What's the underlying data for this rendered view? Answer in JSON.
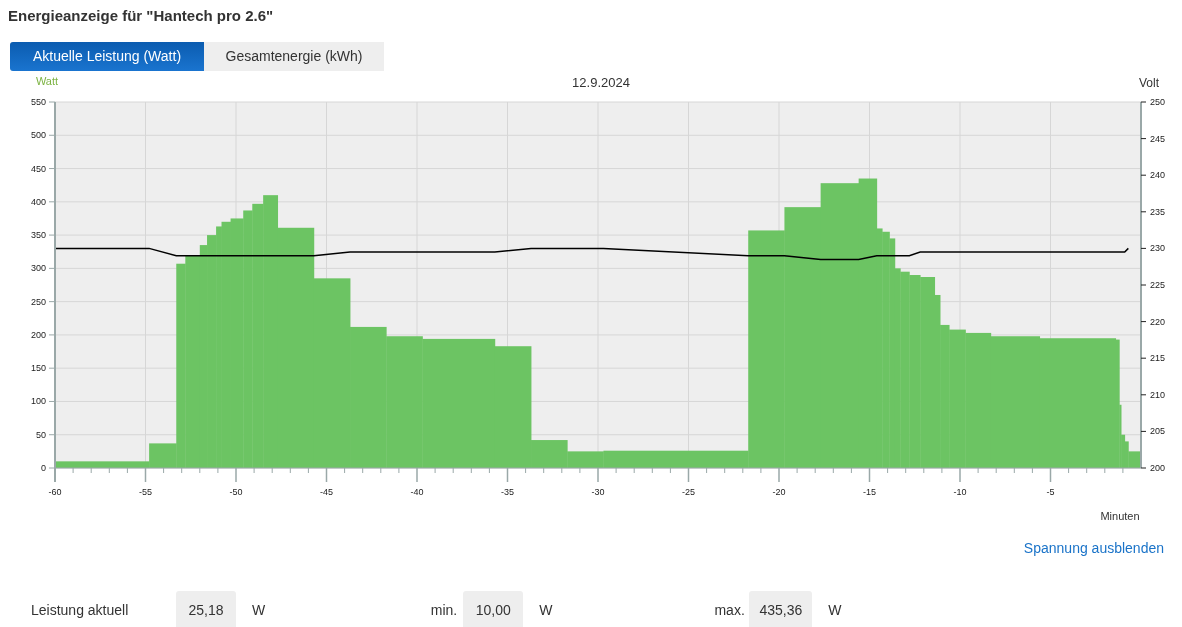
{
  "title": "Energieanzeige für \"Hantech pro 2.6\"",
  "tabs": [
    {
      "label": "Aktuelle Leistung (Watt)",
      "selected": true
    },
    {
      "label": "Gesamtenergie (kWh)",
      "selected": false
    }
  ],
  "chart": {
    "chart_data": {
      "type": "area",
      "title": "12.9.2024",
      "xlabel": "Minuten",
      "ylabel": "Watt",
      "y2label": "Volt",
      "x": [
        -60,
        -54.8,
        -53.3,
        -52.8,
        -52.0,
        -51.6,
        -51.1,
        -50.8,
        -50.3,
        -49.6,
        -49.1,
        -48.5,
        -47.7,
        -45.7,
        -43.7,
        -41.7,
        -39.7,
        -35.7,
        -33.7,
        -31.7,
        -29.7,
        -21.7,
        -19.7,
        -17.7,
        -15.6,
        -14.6,
        -14.3,
        -13.9,
        -13.6,
        -13.3,
        -12.8,
        -12.2,
        -11.4,
        -11.1,
        -10.6,
        -9.7,
        -8.3,
        -5.6,
        -1.4,
        -1.2,
        -1.1,
        -0.9,
        -0.7
      ],
      "series": [
        {
          "color": "#6cc463",
          "values": [
            10,
            37,
            307,
            320,
            335,
            350,
            363,
            370,
            375,
            387,
            397,
            410,
            361,
            285,
            212,
            198,
            194,
            183,
            42,
            25,
            26,
            357,
            392,
            428,
            435,
            360,
            355,
            345,
            300,
            295,
            290,
            287,
            260,
            215,
            208,
            203,
            198,
            195,
            193,
            95,
            50,
            40,
            25
          ]
        },
        {
          "type": "line",
          "axis": "y2",
          "color": "#000000",
          "values": [
            230,
            230,
            229,
            229,
            229,
            229,
            229,
            229,
            229,
            229,
            229,
            229,
            229,
            229,
            229.5,
            229.5,
            229.5,
            229.5,
            230,
            230,
            230,
            229,
            229,
            228.5,
            228.5,
            229,
            229,
            229,
            229,
            229,
            229,
            229.5,
            229.5,
            229.5,
            229.5,
            229.5,
            229.5,
            229.5,
            229.5,
            229.5,
            229.5,
            229.5,
            230
          ]
        }
      ],
      "grid": true,
      "xlim": [
        -60,
        0
      ],
      "ylim": [
        0,
        550
      ],
      "y2lim": [
        200,
        250
      ],
      "xticks": [
        -60,
        -55,
        -50,
        -45,
        -40,
        -35,
        -30,
        -25,
        -20,
        -15,
        -10,
        -5
      ],
      "yticks": [
        0,
        50,
        100,
        150,
        200,
        250,
        300,
        350,
        400,
        450,
        500,
        550
      ],
      "y2ticks": [
        200,
        205,
        210,
        215,
        220,
        225,
        230,
        235,
        240,
        245,
        250
      ]
    }
  },
  "toggle_link": "Spannung ausblenden",
  "stats": [
    {
      "label": "Leistung aktuell",
      "value": "25,18",
      "unit": "W"
    },
    {
      "label": "min.",
      "value": "10,00",
      "unit": "W"
    },
    {
      "label": "max.",
      "value": "435,36",
      "unit": "W"
    }
  ]
}
